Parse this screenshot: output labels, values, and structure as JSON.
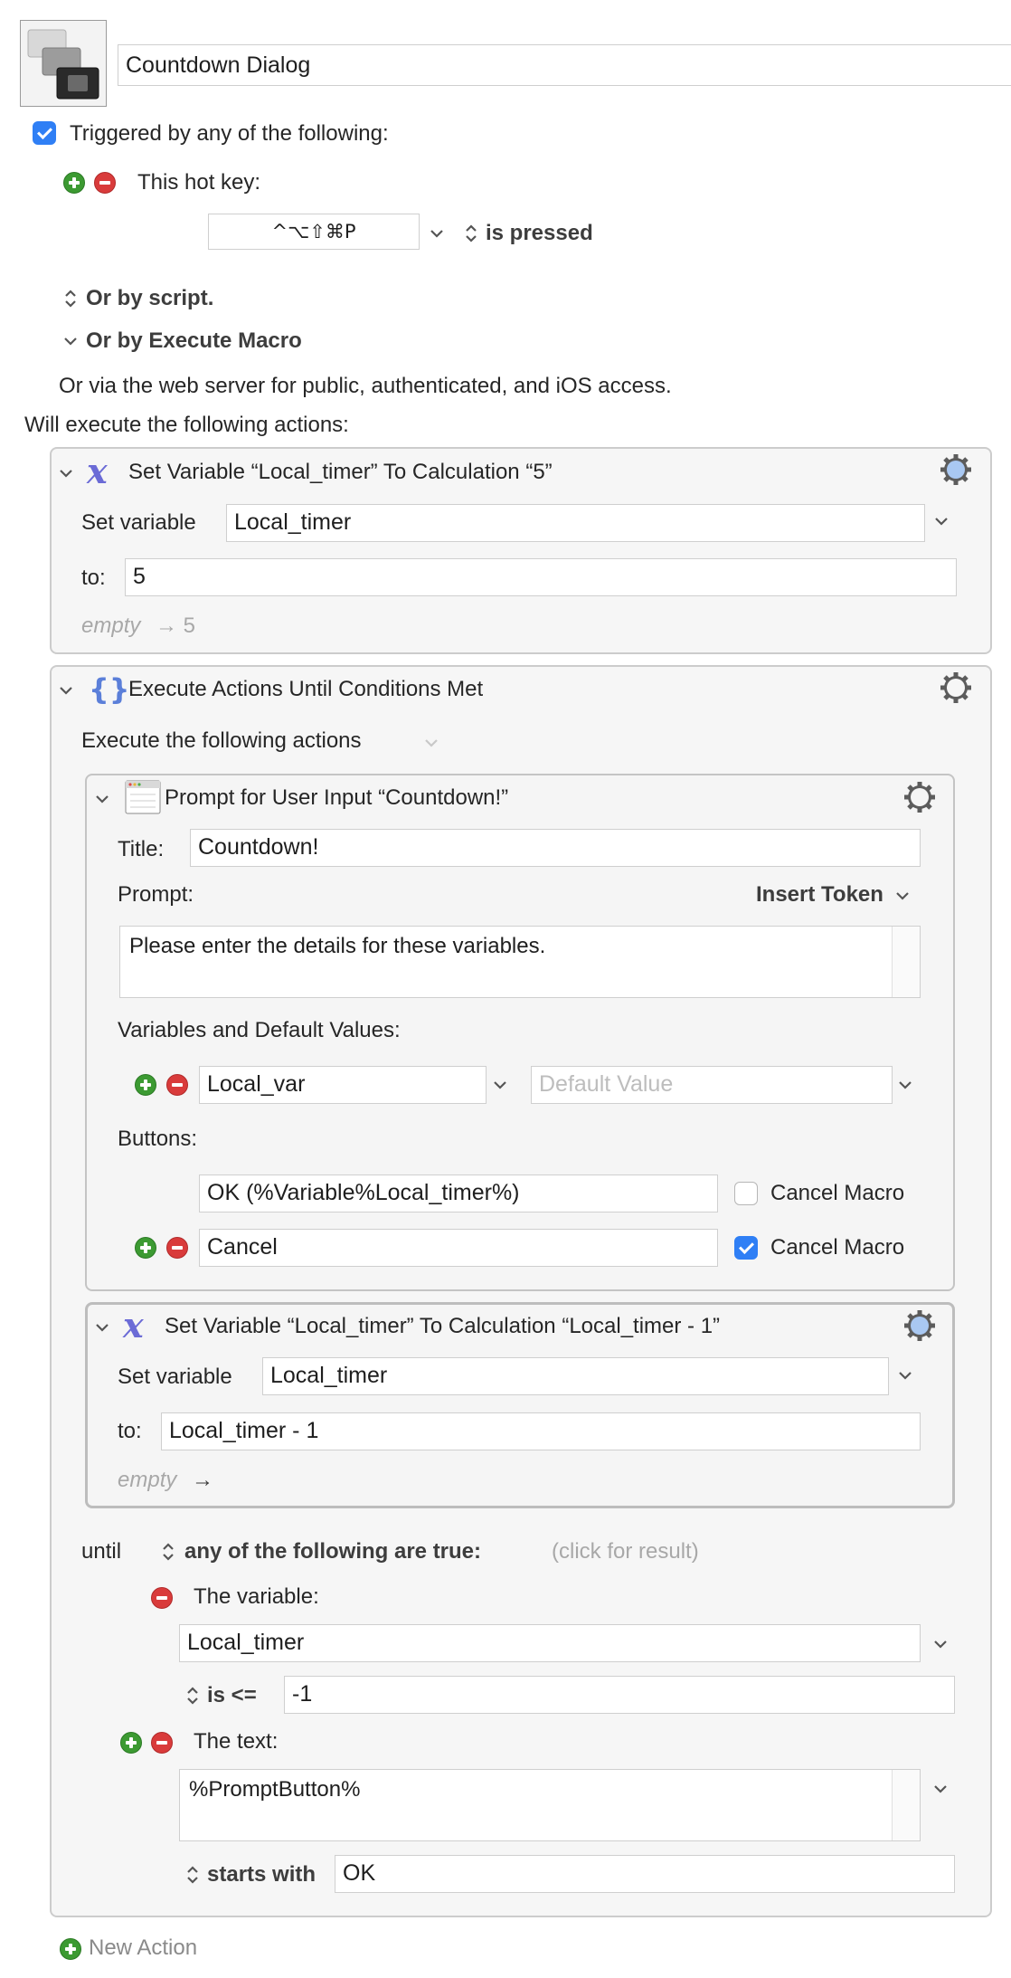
{
  "macro": {
    "name": "Countdown Dialog",
    "icon": "macro-stacked-screens-icon"
  },
  "trigger": {
    "checkbox_label": "Triggered by any of the following:",
    "checked": true,
    "hotkey_label": "This hot key:",
    "hotkey_value": "^⌥⇧⌘P",
    "hotkey_state": "is pressed",
    "or_by_script": "Or by script.",
    "or_by_execute_macro": "Or by Execute Macro",
    "web_server": "Or via the web server for public, authenticated, and iOS access."
  },
  "will_execute": "Will execute the following actions:",
  "action1": {
    "title": "Set Variable “Local_timer” To Calculation “5”",
    "set_variable_label": "Set variable",
    "variable": "Local_timer",
    "to_label": "to:",
    "to_value": "5",
    "result_empty": "empty",
    "result_arrow": "→ 5"
  },
  "action2": {
    "title": "Execute Actions Until Conditions Met",
    "subtitle": "Execute the following actions",
    "prompt": {
      "title": "Prompt for User Input “Countdown!”",
      "title_label": "Title:",
      "title_value": "Countdown!",
      "prompt_label": "Prompt:",
      "insert_token": "Insert Token",
      "prompt_text": "Please enter the details for these variables.",
      "vars_label": "Variables and Default Values:",
      "var_name": "Local_var",
      "default_placeholder": "Default Value",
      "buttons_label": "Buttons:",
      "buttons": [
        {
          "label": "OK (%Variable%Local_timer%)",
          "cancel_macro_label": "Cancel Macro",
          "checked": false
        },
        {
          "label": "Cancel",
          "cancel_macro_label": "Cancel Macro",
          "checked": true
        }
      ]
    },
    "set_var": {
      "title": "Set Variable “Local_timer” To Calculation “Local_timer - 1”",
      "set_variable_label": "Set variable",
      "variable": "Local_timer",
      "to_label": "to:",
      "to_value": "Local_timer - 1",
      "result_empty": "empty",
      "result_arrow": "→"
    },
    "until_label": "until",
    "condition_mode": "any of the following are true:",
    "click_result": "(click for result)",
    "cond1": {
      "label": "The variable:",
      "variable": "Local_timer",
      "op": "is <=",
      "value": "-1"
    },
    "cond2": {
      "label": "The text:",
      "text": "%PromptButton%",
      "op": "starts with",
      "value": "OK"
    }
  },
  "new_action": "New Action",
  "colors": {
    "accent": "#2f7ff5",
    "add": "#3c9a32",
    "remove": "#d93b3b"
  }
}
